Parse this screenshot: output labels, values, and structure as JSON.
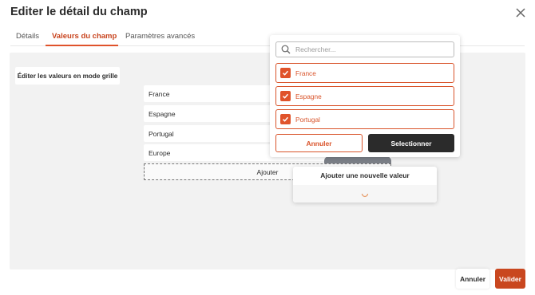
{
  "dialog": {
    "title": "Editer le détail du champ",
    "close_icon": "close-icon"
  },
  "tabs": [
    {
      "label": "Détails",
      "active": false
    },
    {
      "label": "Valeurs du champ",
      "active": true
    },
    {
      "label": "Paramètres avancés",
      "active": false
    }
  ],
  "colors": {
    "accent": "#e0532b",
    "dark_button": "#2b2b2b",
    "content_bg": "#f2f2f2"
  },
  "toolbar": {
    "grid_mode_label": "Éditer les valeurs en mode grille"
  },
  "values": [
    "France",
    "Espagne",
    "Portugal",
    "Europe"
  ],
  "add_label": "Ajouter",
  "dropdown": {
    "search_placeholder": "Rechercher...",
    "search_icon": "search-icon",
    "options": [
      {
        "label": "France",
        "checked": true
      },
      {
        "label": "Espagne",
        "checked": true
      },
      {
        "label": "Portugal",
        "checked": true
      }
    ],
    "cancel_label": "Annuler",
    "select_label": "Selectionner"
  },
  "popover": {
    "title": "Ajouter une nouvelle valeur",
    "spinner_icon": "spinner-icon"
  },
  "footer": {
    "cancel_label": "Annuler",
    "ok_label": "Valider"
  }
}
